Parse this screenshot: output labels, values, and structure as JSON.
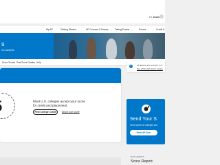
{
  "header": {
    "greeting_prefix": "Hi,",
    "user_name": "Jesus"
  },
  "nav": {
    "items": [
      {
        "label": "My AP",
        "has_menu": false
      },
      {
        "label": "Getting Started",
        "has_menu": true
      },
      {
        "label": "AP Courses & Exams",
        "has_menu": true
      },
      {
        "label": "Taking Exams",
        "has_menu": true
      },
      {
        "label": "Scores",
        "has_menu": true
      },
      {
        "label": "Credit &",
        "has_menu": false
      }
    ]
  },
  "hero": {
    "title": "s",
    "subtitle": "nd awards"
  },
  "subnav": {
    "items": [
      "Score Scores",
      "Past Score Grades",
      "Help"
    ]
  },
  "score_card": {
    "seal_number": "5",
    "message": "Most U.S. colleges accept your score for credit and placement.",
    "find_button": "Find College Credit",
    "about_link": "About your score"
  },
  "notice": {
    "text": "AP Exams are scored 1 to 5.",
    "link": "See what each score means"
  },
  "send_card": {
    "title": "Send Your S",
    "subtitle": "Send scores to colleges and",
    "button": "Send AP Scor"
  },
  "document": {
    "label": "DOCUMENT",
    "title": "Score Report"
  },
  "colors": {
    "brand_blue": "#0077c8",
    "background": "#f0f0f0",
    "text": "#1e1e1e"
  }
}
